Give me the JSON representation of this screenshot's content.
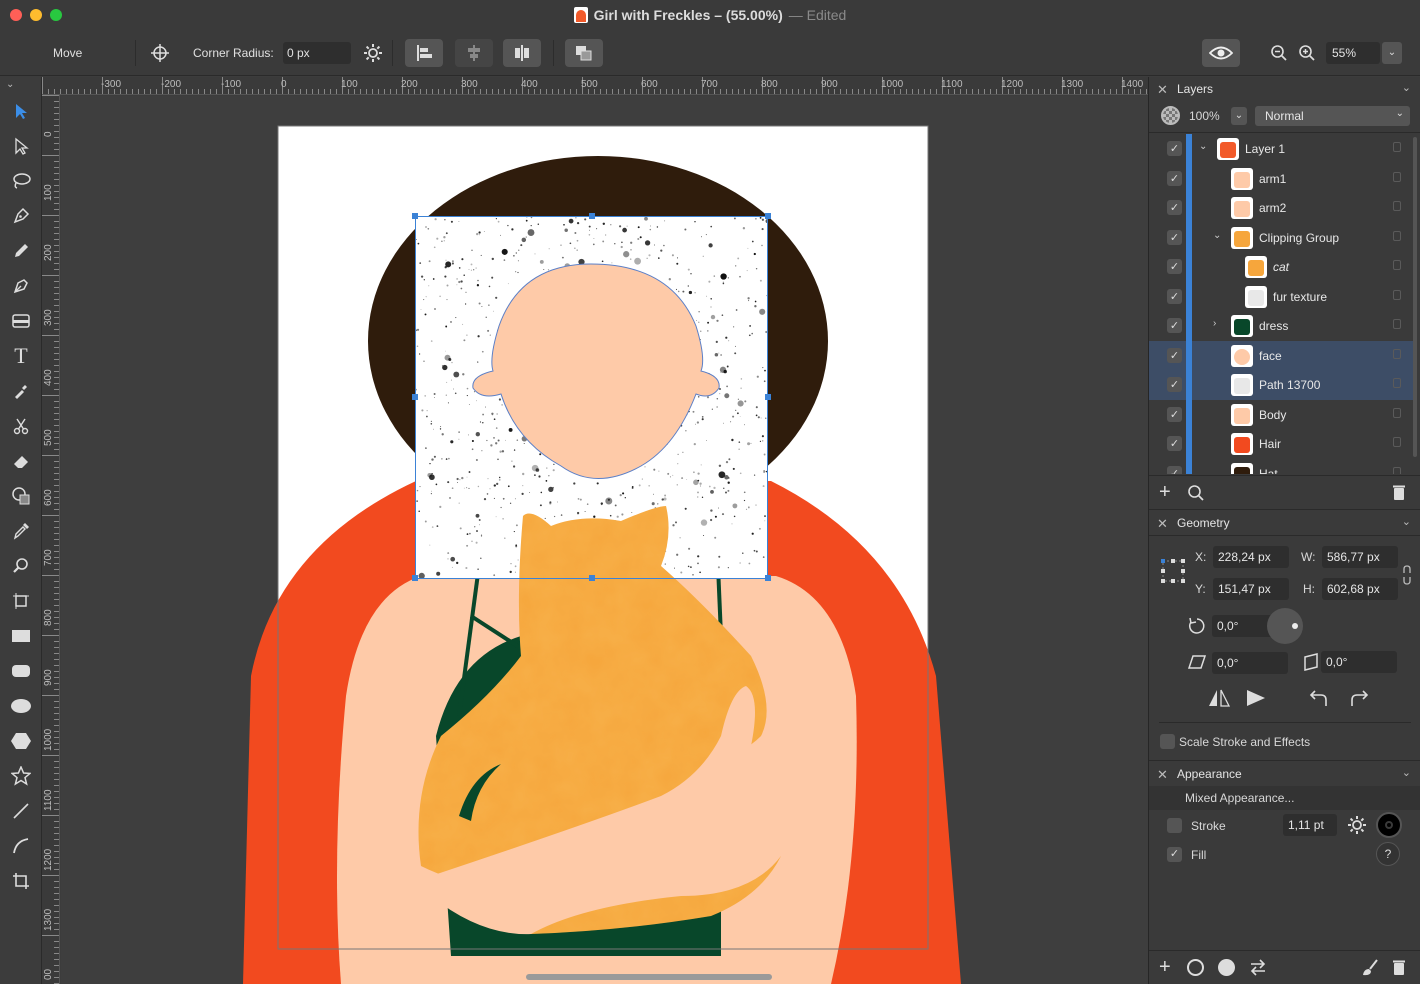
{
  "window": {
    "title": "Girl with Freckles – (55.00%)",
    "edited": "— Edited",
    "traffic_colors": [
      "#ff5f57",
      "#febc2e",
      "#28c840"
    ]
  },
  "toolbar": {
    "tool_name": "Move",
    "corner_radius_label": "Corner Radius:",
    "corner_radius_value": "0 px",
    "zoom_value": "55%"
  },
  "rulers": {
    "unit": "px",
    "top": [
      "-300",
      "-200",
      "-100",
      "0",
      "100",
      "200",
      "300",
      "400",
      "500",
      "600",
      "700",
      "800",
      "900",
      "1000",
      "1100",
      "1200",
      "1300",
      "1400"
    ],
    "left": [
      "0",
      "100",
      "200",
      "300",
      "400",
      "500",
      "600",
      "700",
      "800",
      "900",
      "1000",
      "1100",
      "1200",
      "1300",
      "00"
    ]
  },
  "layers_panel": {
    "title": "Layers",
    "opacity": "100%",
    "blend_mode": "Normal",
    "items": [
      {
        "name": "Layer 1",
        "checked": true,
        "selected": false,
        "italic": false,
        "twisty": "v",
        "thumb": "layer"
      },
      {
        "name": "arm1",
        "checked": true,
        "selected": false,
        "italic": false,
        "twisty": "",
        "thumb": "arm"
      },
      {
        "name": "arm2",
        "checked": true,
        "selected": false,
        "italic": false,
        "twisty": "",
        "thumb": "arm"
      },
      {
        "name": "Clipping Group",
        "checked": true,
        "selected": false,
        "italic": false,
        "twisty": "v",
        "thumb": "cat"
      },
      {
        "name": "cat",
        "checked": true,
        "selected": false,
        "italic": true,
        "twisty": "",
        "thumb": "cat"
      },
      {
        "name": "fur texture",
        "checked": true,
        "selected": false,
        "italic": false,
        "twisty": "",
        "thumb": "texture"
      },
      {
        "name": "dress",
        "checked": true,
        "selected": false,
        "italic": false,
        "twisty": ">",
        "thumb": "dress"
      },
      {
        "name": "face",
        "checked": true,
        "selected": true,
        "italic": false,
        "twisty": "",
        "thumb": "face"
      },
      {
        "name": "Path 13700",
        "checked": true,
        "selected": true,
        "italic": false,
        "twisty": "",
        "thumb": "texture"
      },
      {
        "name": "Body",
        "checked": true,
        "selected": false,
        "italic": false,
        "twisty": "",
        "thumb": "body"
      },
      {
        "name": "Hair",
        "checked": true,
        "selected": false,
        "italic": false,
        "twisty": "",
        "thumb": "hair"
      },
      {
        "name": "Hat",
        "checked": true,
        "selected": false,
        "italic": false,
        "twisty": "",
        "thumb": "hat"
      }
    ]
  },
  "geometry_panel": {
    "title": "Geometry",
    "x_label": "X:",
    "x_value": "228,24 px",
    "y_label": "Y:",
    "y_value": "151,47 px",
    "w_label": "W:",
    "w_value": "586,77 px",
    "h_label": "H:",
    "h_value": "602,68 px",
    "rotation": "0,0°",
    "skew_h": "0,0°",
    "skew_v": "0,0°",
    "scale_stroke_label": "Scale Stroke and Effects"
  },
  "appearance_panel": {
    "title": "Appearance",
    "summary": "Mixed Appearance...",
    "stroke_label": "Stroke",
    "stroke_value": "1,11 pt",
    "fill_label": "Fill",
    "help": "?"
  },
  "colors": {
    "selection": "#3b82d6",
    "hair": "#2f1c0c",
    "coat": "#f24a1f",
    "skin": "#fecaa8",
    "cat": "#f6a63c",
    "dress": "#08472a"
  }
}
